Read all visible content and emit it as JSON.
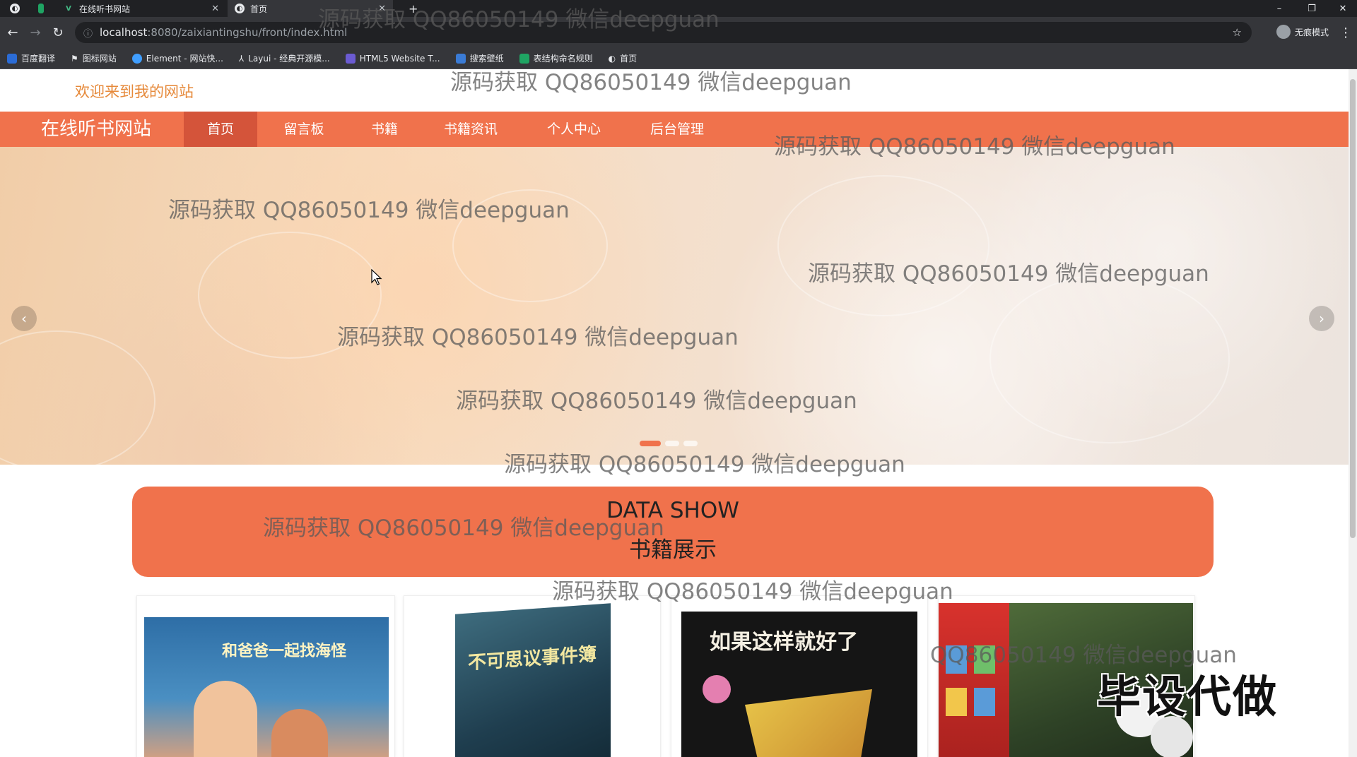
{
  "browser": {
    "tabs": [
      {
        "title": "在线听书网站"
      },
      {
        "title": "首页"
      }
    ],
    "new_tab_label": "+",
    "url_host": "localhost",
    "url_path": ":8080/zaixiantingshu/front/index.html",
    "profile_label": "无痕模式",
    "bookmarks": [
      {
        "label": "百度翻译",
        "color": "#2b6cd6"
      },
      {
        "label": "图标网站",
        "color": "#e8eaed"
      },
      {
        "label": "Element - 网站快...",
        "color": "#409eff"
      },
      {
        "label": "Layui - 经典开源模...",
        "color": "#e8eaed"
      },
      {
        "label": "HTML5 Website T...",
        "color": "#6b5bd2"
      },
      {
        "label": "搜索壁纸",
        "color": "#3a7bd5"
      },
      {
        "label": "表结构命名规则",
        "color": "#1fa463"
      },
      {
        "label": "首页",
        "color": "#e8eaed"
      }
    ]
  },
  "page": {
    "welcome": "欢迎来到我的网站",
    "site_name": "在线听书网站",
    "nav": [
      "首页",
      "留言板",
      "书籍",
      "书籍资讯",
      "个人中心",
      "后台管理"
    ],
    "active_nav": 0,
    "banner": {
      "prev": "‹",
      "next": "›",
      "slide_count": 3,
      "active_slide": 0
    },
    "section_title_en": "DATA SHOW",
    "section_title_cn": "书籍展示",
    "books": [
      {
        "cover_title": "和爸爸一起找海怪"
      },
      {
        "cover_title": "不可思议事件簿"
      },
      {
        "cover_title": "如果这样就好了"
      },
      {
        "cover_title": ""
      }
    ]
  },
  "overlay": {
    "watermark": "源码获取 QQ86050149 微信deepguan",
    "watermark_partial": "QQ86050149 微信deepguan",
    "stamp": "毕设代做"
  },
  "colors": {
    "accent": "#f0724c",
    "accent_dark": "#d4543a",
    "welcome": "#e6893a"
  }
}
